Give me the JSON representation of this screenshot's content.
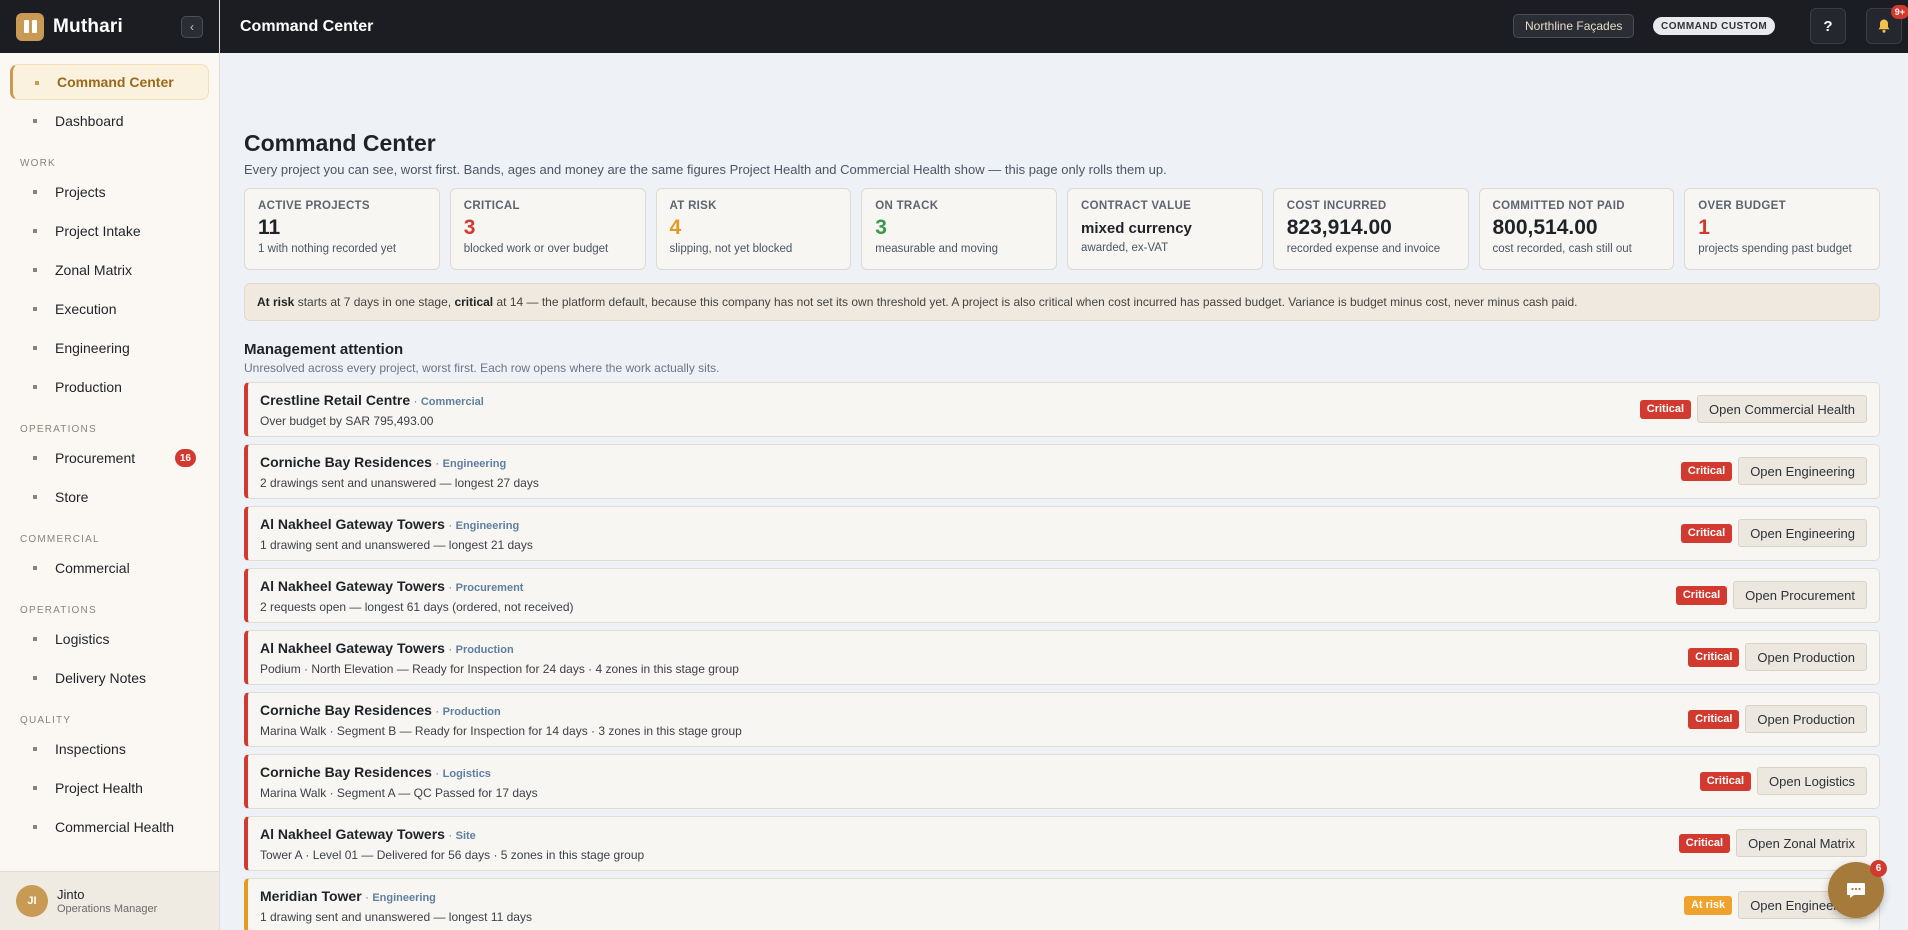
{
  "brand": {
    "name": "Muthari"
  },
  "sidebar": {
    "top_items": [
      {
        "label": "Command Center",
        "active": true
      },
      {
        "label": "Dashboard"
      }
    ],
    "sections": [
      {
        "title": "Work",
        "items": [
          {
            "label": "Projects"
          },
          {
            "label": "Project Intake"
          },
          {
            "label": "Zonal Matrix"
          },
          {
            "label": "Execution"
          },
          {
            "label": "Engineering"
          },
          {
            "label": "Production"
          }
        ]
      },
      {
        "title": "Operations",
        "items": [
          {
            "label": "Procurement",
            "badge": "16"
          },
          {
            "label": "Store"
          }
        ]
      },
      {
        "title": "Commercial",
        "items": [
          {
            "label": "Commercial"
          }
        ]
      },
      {
        "title": "Operations",
        "items": [
          {
            "label": "Logistics"
          },
          {
            "label": "Delivery Notes"
          }
        ]
      },
      {
        "title": "Quality",
        "items": [
          {
            "label": "Inspections"
          },
          {
            "label": "Project Health"
          },
          {
            "label": "Commercial Health"
          }
        ]
      }
    ],
    "user": {
      "initials": "JI",
      "name": "Jinto",
      "role": "Operations Manager"
    }
  },
  "topbar": {
    "title": "Command Center",
    "tenant": "Northline Façades",
    "mode": "COMMAND CUSTOM",
    "help": "?",
    "notifications": "9+"
  },
  "page": {
    "title": "Command Center",
    "subtitle": "Every project you can see, worst first. Bands, ages and money are the same figures Project Health and Commercial Health show — this page only rolls them up."
  },
  "kpis": [
    {
      "label": "Active Projects",
      "value": "11",
      "note": "1 with nothing recorded yet",
      "tone": ""
    },
    {
      "label": "Critical",
      "value": "3",
      "note": "blocked work or over budget",
      "tone": "red"
    },
    {
      "label": "At Risk",
      "value": "4",
      "note": "slipping, not yet blocked",
      "tone": "amber"
    },
    {
      "label": "On Track",
      "value": "3",
      "note": "measurable and moving",
      "tone": "green"
    },
    {
      "label": "Contract Value",
      "value": "mixed currency",
      "note": "awarded, ex-VAT",
      "tone": "small"
    },
    {
      "label": "Cost Incurred",
      "value": "823,914.00",
      "note": "recorded expense and invoice",
      "tone": ""
    },
    {
      "label": "Committed Not Paid",
      "value": "800,514.00",
      "note": "cost recorded, cash still out",
      "tone": ""
    },
    {
      "label": "Over Budget",
      "value": "1",
      "note": "projects spending past budget",
      "tone": "red"
    }
  ],
  "notice": {
    "at_risk_label": "At risk",
    "part1": " starts at 7 days in one stage, ",
    "critical_label": "critical",
    "part2": " at 14 — the platform default, because this company has not set its own threshold yet. A project is also critical when cost incurred has passed budget. Variance is budget minus cost, never minus cash paid."
  },
  "attention": {
    "title": "Management attention",
    "subtitle": "Unresolved across every project, worst first. Each row opens where the work actually sits.",
    "rows": [
      {
        "project": "Crestline Retail Centre",
        "area": "Commercial",
        "desc": "Over budget by SAR 795,493.00",
        "status": "Critical",
        "action": "Open Commercial Health",
        "tone": "red"
      },
      {
        "project": "Corniche Bay Residences",
        "area": "Engineering",
        "desc": "2 drawings sent and unanswered — longest 27 days",
        "status": "Critical",
        "action": "Open Engineering",
        "tone": "red"
      },
      {
        "project": "Al Nakheel Gateway Towers",
        "area": "Engineering",
        "desc": "1 drawing sent and unanswered — longest 21 days",
        "status": "Critical",
        "action": "Open Engineering",
        "tone": "red"
      },
      {
        "project": "Al Nakheel Gateway Towers",
        "area": "Procurement",
        "desc": "2 requests open — longest 61 days (ordered, not received)",
        "status": "Critical",
        "action": "Open Procurement",
        "tone": "red"
      },
      {
        "project": "Al Nakheel Gateway Towers",
        "area": "Production",
        "desc": "Podium · North Elevation — Ready for Inspection for 24 days · 4 zones in this stage group",
        "status": "Critical",
        "action": "Open Production",
        "tone": "red"
      },
      {
        "project": "Corniche Bay Residences",
        "area": "Production",
        "desc": "Marina Walk · Segment B — Ready for Inspection for 14 days · 3 zones in this stage group",
        "status": "Critical",
        "action": "Open Production",
        "tone": "red"
      },
      {
        "project": "Corniche Bay Residences",
        "area": "Logistics",
        "desc": "Marina Walk · Segment A — QC Passed for 17 days",
        "status": "Critical",
        "action": "Open Logistics",
        "tone": "red"
      },
      {
        "project": "Al Nakheel Gateway Towers",
        "area": "Site",
        "desc": "Tower A · Level 01 — Delivered for 56 days · 5 zones in this stage group",
        "status": "Critical",
        "action": "Open Zonal Matrix",
        "tone": "red"
      },
      {
        "project": "Meridian Tower",
        "area": "Engineering",
        "desc": "1 drawing sent and unanswered — longest 11 days",
        "status": "At risk",
        "action": "Open Engineering",
        "tone": "amber"
      }
    ]
  },
  "chat": {
    "badge": "6"
  },
  "colors": {
    "accent": "#c89a54",
    "critical": "#d23a2f",
    "at_risk": "#e39b24",
    "on_track": "#3a9a4a",
    "topbar": "#1b1d22"
  }
}
